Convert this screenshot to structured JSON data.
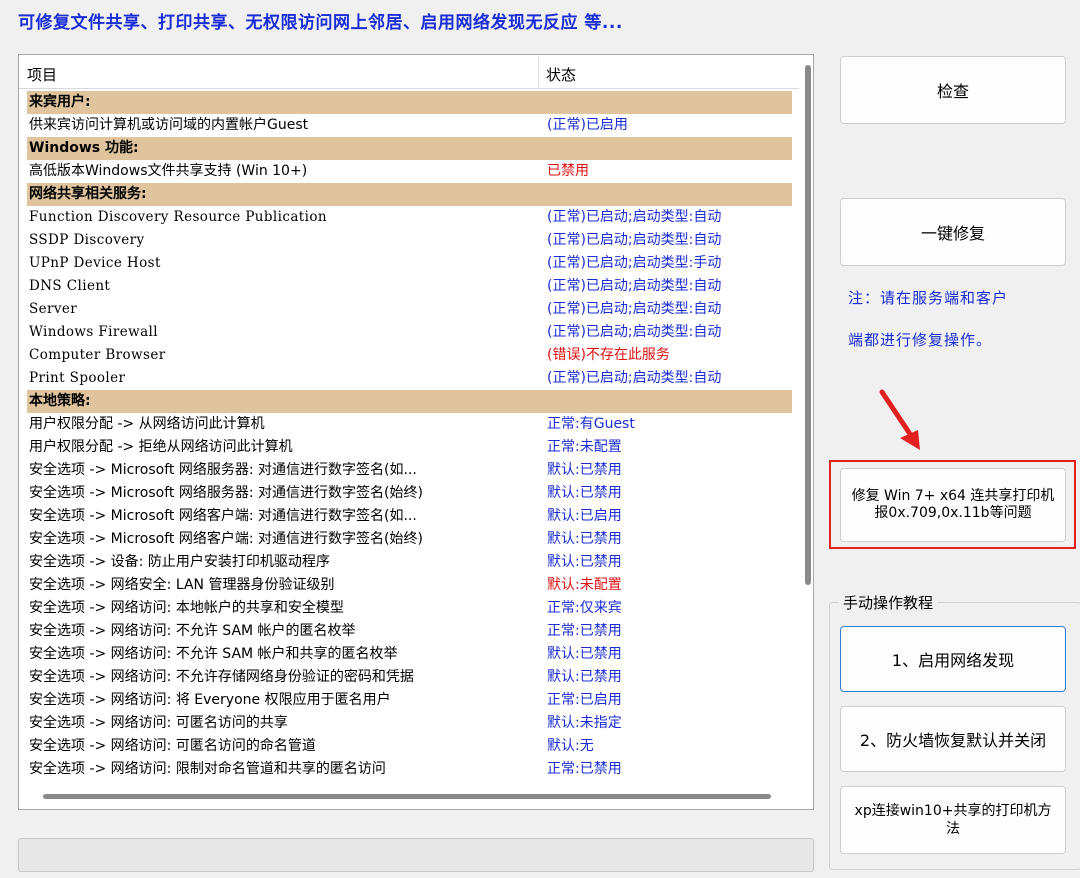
{
  "banner": "可修复文件共享、打印共享、无权限访问网上邻居、启用网络发现无反应  等...",
  "list": {
    "col_item": "项目",
    "col_status": "状态",
    "rows": [
      {
        "type": "section",
        "c1": "来宾用户:",
        "c2": ""
      },
      {
        "type": "row",
        "c1": "供来宾访问计算机或访问域的内置帐户Guest",
        "c2": "(正常)已启用",
        "color": "blue"
      },
      {
        "type": "section",
        "c1": "Windows 功能:",
        "c2": ""
      },
      {
        "type": "row",
        "c1": "高低版本Windows文件共享支持 (Win 10+)",
        "c2": "已禁用",
        "color": "red"
      },
      {
        "type": "section",
        "c1": "网络共享相关服务:",
        "c2": ""
      },
      {
        "type": "row",
        "c1": "Function Discovery Resource Publication",
        "c2": "(正常)已启动;启动类型:自动",
        "color": "blue",
        "mono": true
      },
      {
        "type": "row",
        "c1": "SSDP Discovery",
        "c2": "(正常)已启动;启动类型:自动",
        "color": "blue",
        "mono": true
      },
      {
        "type": "row",
        "c1": "UPnP Device Host",
        "c2": "(正常)已启动;启动类型:手动",
        "color": "blue",
        "mono": true
      },
      {
        "type": "row",
        "c1": "DNS Client",
        "c2": "(正常)已启动;启动类型:自动",
        "color": "blue",
        "mono": true
      },
      {
        "type": "row",
        "c1": "Server",
        "c2": "(正常)已启动;启动类型:自动",
        "color": "blue",
        "mono": true
      },
      {
        "type": "row",
        "c1": "Windows Firewall",
        "c2": "(正常)已启动;启动类型:自动",
        "color": "blue",
        "mono": true
      },
      {
        "type": "row",
        "c1": "Computer Browser",
        "c2": "(错误)不存在此服务",
        "color": "red",
        "mono": true
      },
      {
        "type": "row",
        "c1": "Print Spooler",
        "c2": "(正常)已启动;启动类型:自动",
        "color": "blue",
        "mono": true
      },
      {
        "type": "section",
        "c1": "本地策略:",
        "c2": ""
      },
      {
        "type": "row",
        "c1": "用户权限分配 -> 从网络访问此计算机",
        "c2": "正常:有Guest",
        "color": "blue"
      },
      {
        "type": "row",
        "c1": "用户权限分配 -> 拒绝从网络访问此计算机",
        "c2": "正常:未配置",
        "color": "blue"
      },
      {
        "type": "row",
        "c1": "安全选项 -> Microsoft 网络服务器: 对通信进行数字签名(如...",
        "c2": "默认:已禁用",
        "color": "blue"
      },
      {
        "type": "row",
        "c1": "安全选项 -> Microsoft 网络服务器: 对通信进行数字签名(始终)",
        "c2": "默认:已禁用",
        "color": "blue"
      },
      {
        "type": "row",
        "c1": "安全选项 -> Microsoft 网络客户端: 对通信进行数字签名(如...",
        "c2": "默认:已启用",
        "color": "blue"
      },
      {
        "type": "row",
        "c1": "安全选项 -> Microsoft 网络客户端: 对通信进行数字签名(始终)",
        "c2": "默认:已禁用",
        "color": "blue"
      },
      {
        "type": "row",
        "c1": "安全选项 -> 设备: 防止用户安装打印机驱动程序",
        "c2": "默认:已禁用",
        "color": "blue"
      },
      {
        "type": "row",
        "c1": "安全选项 -> 网络安全: LAN 管理器身份验证级别",
        "c2": "默认:未配置",
        "color": "red"
      },
      {
        "type": "row",
        "c1": "安全选项 -> 网络访问: 本地帐户的共享和安全模型",
        "c2": "正常:仅来宾",
        "color": "blue"
      },
      {
        "type": "row",
        "c1": "安全选项 -> 网络访问: 不允许 SAM 帐户的匿名枚举",
        "c2": "正常:已禁用",
        "color": "blue"
      },
      {
        "type": "row",
        "c1": "安全选项 -> 网络访问: 不允许 SAM 帐户和共享的匿名枚举",
        "c2": "默认:已禁用",
        "color": "blue"
      },
      {
        "type": "row",
        "c1": "安全选项 -> 网络访问: 不允许存储网络身份验证的密码和凭据",
        "c2": "默认:已禁用",
        "color": "blue"
      },
      {
        "type": "row",
        "c1": "安全选项 -> 网络访问: 将 Everyone 权限应用于匿名用户",
        "c2": "正常:已启用",
        "color": "blue"
      },
      {
        "type": "row",
        "c1": "安全选项 -> 网络访问: 可匿名访问的共享",
        "c2": "默认:未指定",
        "color": "blue"
      },
      {
        "type": "row",
        "c1": "安全选项 -> 网络访问: 可匿名访问的命名管道",
        "c2": "默认:无",
        "color": "blue"
      },
      {
        "type": "row",
        "c1": "安全选项 -> 网络访问: 限制对命名管道和共享的匿名访问",
        "c2": "正常:已禁用",
        "color": "blue"
      }
    ]
  },
  "buttons": {
    "check": "检查",
    "one_click_fix": "一键修复",
    "win7_fix": "修复 Win 7+ x64 连共享打印机报0x.709,0x.11b等问题"
  },
  "note": {
    "line1": "注：请在服务端和客户",
    "line2": "端都进行修复操作。"
  },
  "manual": {
    "title": "手动操作教程",
    "btn1": "1、启用网络发现",
    "btn2": "2、防火墙恢复默认并关闭",
    "btn3": "xp连接win10+共享的打印机方法"
  },
  "colors": {
    "accent_blue": "#1a2dd6",
    "error_red": "#e01010",
    "section_bg": "#dfc49d",
    "highlight_red": "#e32020"
  },
  "icons": {
    "arrow": "red-arrow-icon"
  }
}
